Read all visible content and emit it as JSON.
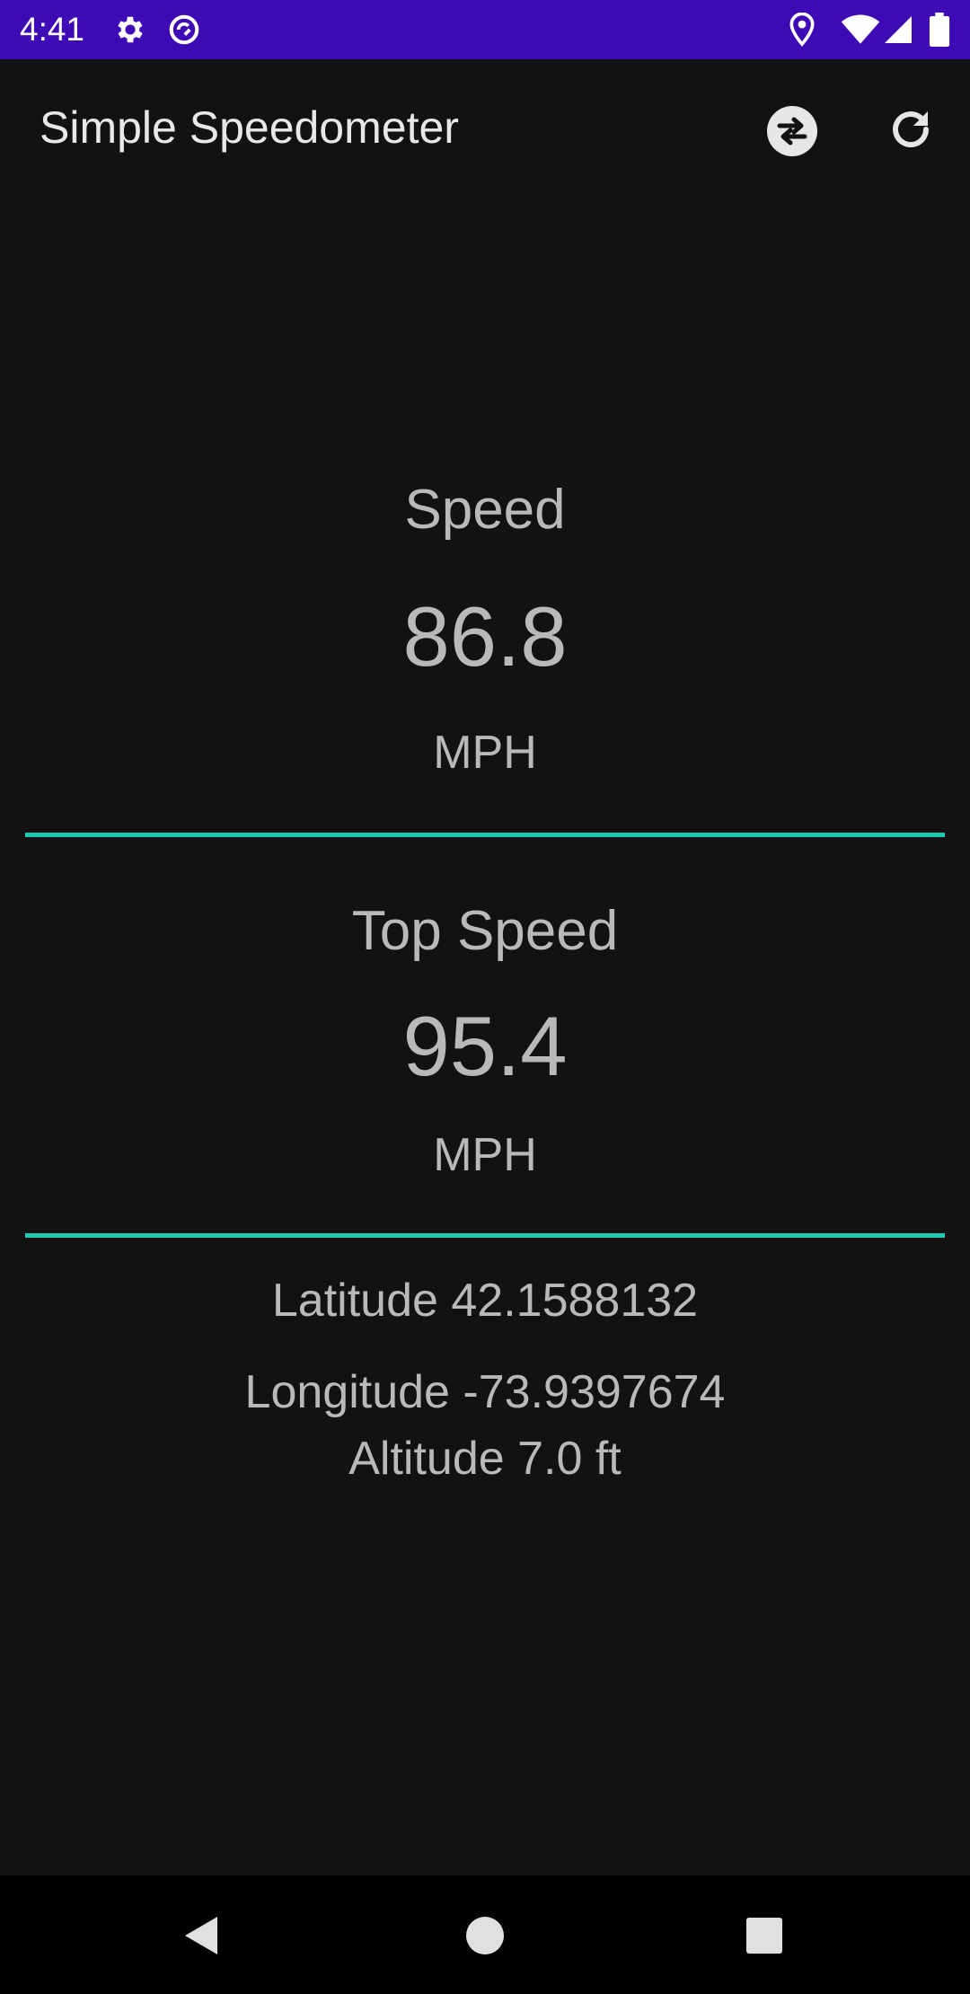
{
  "status_bar": {
    "time": "4:41",
    "background": "#3e0ab5",
    "icons": [
      "gear-icon",
      "sync-circle-icon",
      "location-icon",
      "wifi-icon",
      "signal-icon",
      "battery-icon"
    ]
  },
  "app_bar": {
    "title": "Simple Speedometer",
    "actions": [
      "swap-units-icon",
      "reset-icon"
    ]
  },
  "speed": {
    "label": "Speed",
    "value": "86.8",
    "unit": "MPH"
  },
  "top_speed": {
    "label": "Top Speed",
    "value": "95.4",
    "unit": "MPH"
  },
  "location": {
    "latitude": "Latitude  42.1588132",
    "longitude": "Longitude  -73.9397674",
    "altitude": "Altitude  7.0 ft"
  },
  "colors": {
    "accent": "#1ec8b4",
    "background": "#121212",
    "text": "#b9b9b9"
  },
  "nav_bar": {
    "buttons": [
      "back-icon",
      "home-icon",
      "recents-icon"
    ]
  }
}
